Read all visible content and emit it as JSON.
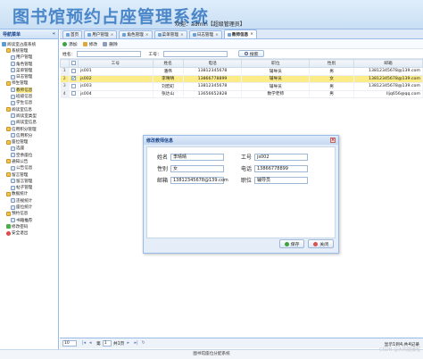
{
  "app": {
    "title": "图书馆预约占座管理系统",
    "welcome": "欢迎：admin【超级管理员】"
  },
  "sidebar": {
    "title": "导航菜单",
    "collapse": "«",
    "items": [
      {
        "label": "阅读室占座系统",
        "icon": "root"
      },
      {
        "label": "系统管理",
        "icon": "folder"
      },
      {
        "label": "用户管理",
        "icon": "leaf"
      },
      {
        "label": "角色管理",
        "icon": "leaf"
      },
      {
        "label": "菜单管理",
        "icon": "leaf"
      },
      {
        "label": "日志管理",
        "icon": "leaf"
      },
      {
        "label": "师生管理",
        "icon": "folder"
      },
      {
        "label": "教师信息",
        "icon": "leaf"
      },
      {
        "label": "班级信息",
        "icon": "leaf"
      },
      {
        "label": "学生信息",
        "icon": "leaf"
      },
      {
        "label": "阅读室信息",
        "icon": "folder"
      },
      {
        "label": "阅读室类型",
        "icon": "leaf"
      },
      {
        "label": "阅读室信息",
        "icon": "leaf"
      },
      {
        "label": "信用积分管理",
        "icon": "folder"
      },
      {
        "label": "信用积分",
        "icon": "leaf"
      },
      {
        "label": "座位管理",
        "icon": "folder"
      },
      {
        "label": "选座",
        "icon": "leaf"
      },
      {
        "label": "空余座位",
        "icon": "leaf"
      },
      {
        "label": "通知公告",
        "icon": "folder"
      },
      {
        "label": "公告信息",
        "icon": "leaf"
      },
      {
        "label": "留言管理",
        "icon": "folder"
      },
      {
        "label": "留言管理",
        "icon": "leaf"
      },
      {
        "label": "帖子管理",
        "icon": "leaf"
      },
      {
        "label": "数据统计",
        "icon": "folder"
      },
      {
        "label": "违规统计",
        "icon": "leaf"
      },
      {
        "label": "座位统计",
        "icon": "leaf"
      },
      {
        "label": "预约信息",
        "icon": "folder"
      },
      {
        "label": "书籍推荐",
        "icon": "leaf"
      },
      {
        "label": "修改密码",
        "icon": "green"
      },
      {
        "label": "安全退出",
        "icon": "red"
      }
    ]
  },
  "tabs": [
    {
      "label": "首页"
    },
    {
      "label": "用户管理"
    },
    {
      "label": "角色管理"
    },
    {
      "label": "菜单管理"
    },
    {
      "label": "日志管理"
    },
    {
      "label": "教师信息",
      "active": true
    }
  ],
  "toolbar": {
    "add": "添加",
    "edit": "修改",
    "delete": "删除"
  },
  "search": {
    "name_label": "姓名：",
    "id_label": "工号：",
    "button": "搜索"
  },
  "table": {
    "headers": [
      "",
      "",
      "工号",
      "姓名",
      "电话",
      "职位",
      "性别",
      "邮箱"
    ],
    "rows": [
      {
        "n": "1",
        "id": "js001",
        "name": "潘伟",
        "phone": "13812345678",
        "pos": "辅导员",
        "sex": "男",
        "email": "13812345678@139.com",
        "checked": false
      },
      {
        "n": "2",
        "id": "js002",
        "name": "李晴晴",
        "phone": "13866778899",
        "pos": "辅导员",
        "sex": "女",
        "email": "13812345678@139.com",
        "checked": true
      },
      {
        "n": "3",
        "id": "js003",
        "name": "刘宏町",
        "phone": "13812345678",
        "pos": "辅导员",
        "sex": "男",
        "email": "13812345678@139.com",
        "checked": false
      },
      {
        "n": "4",
        "id": "js004",
        "name": "张达山",
        "phone": "13656652828",
        "pos": "数学老师",
        "sex": "男",
        "email": "lljq656@qq.com",
        "checked": false
      }
    ]
  },
  "pager": {
    "size": "10",
    "page_prefix": "第",
    "page": "1",
    "page_suffix": "共1页",
    "info": "显示1到4,共4记录"
  },
  "dialog": {
    "title": "修改教师信息",
    "name_label": "姓名",
    "name": "李晴晴",
    "id_label": "工号",
    "id": "js002",
    "sex_label": "性别",
    "sex": "女",
    "phone_label": "电话",
    "phone": "13866778899",
    "email_label": "邮箱",
    "email": "13812345678@139.com",
    "pos_label": "职位",
    "pos": "辅导员",
    "save": "保存",
    "close": "关闭"
  },
  "footer": {
    "text": "图书馆座位分配系统",
    "watermark": "CSDN @大鸡腿编程"
  }
}
